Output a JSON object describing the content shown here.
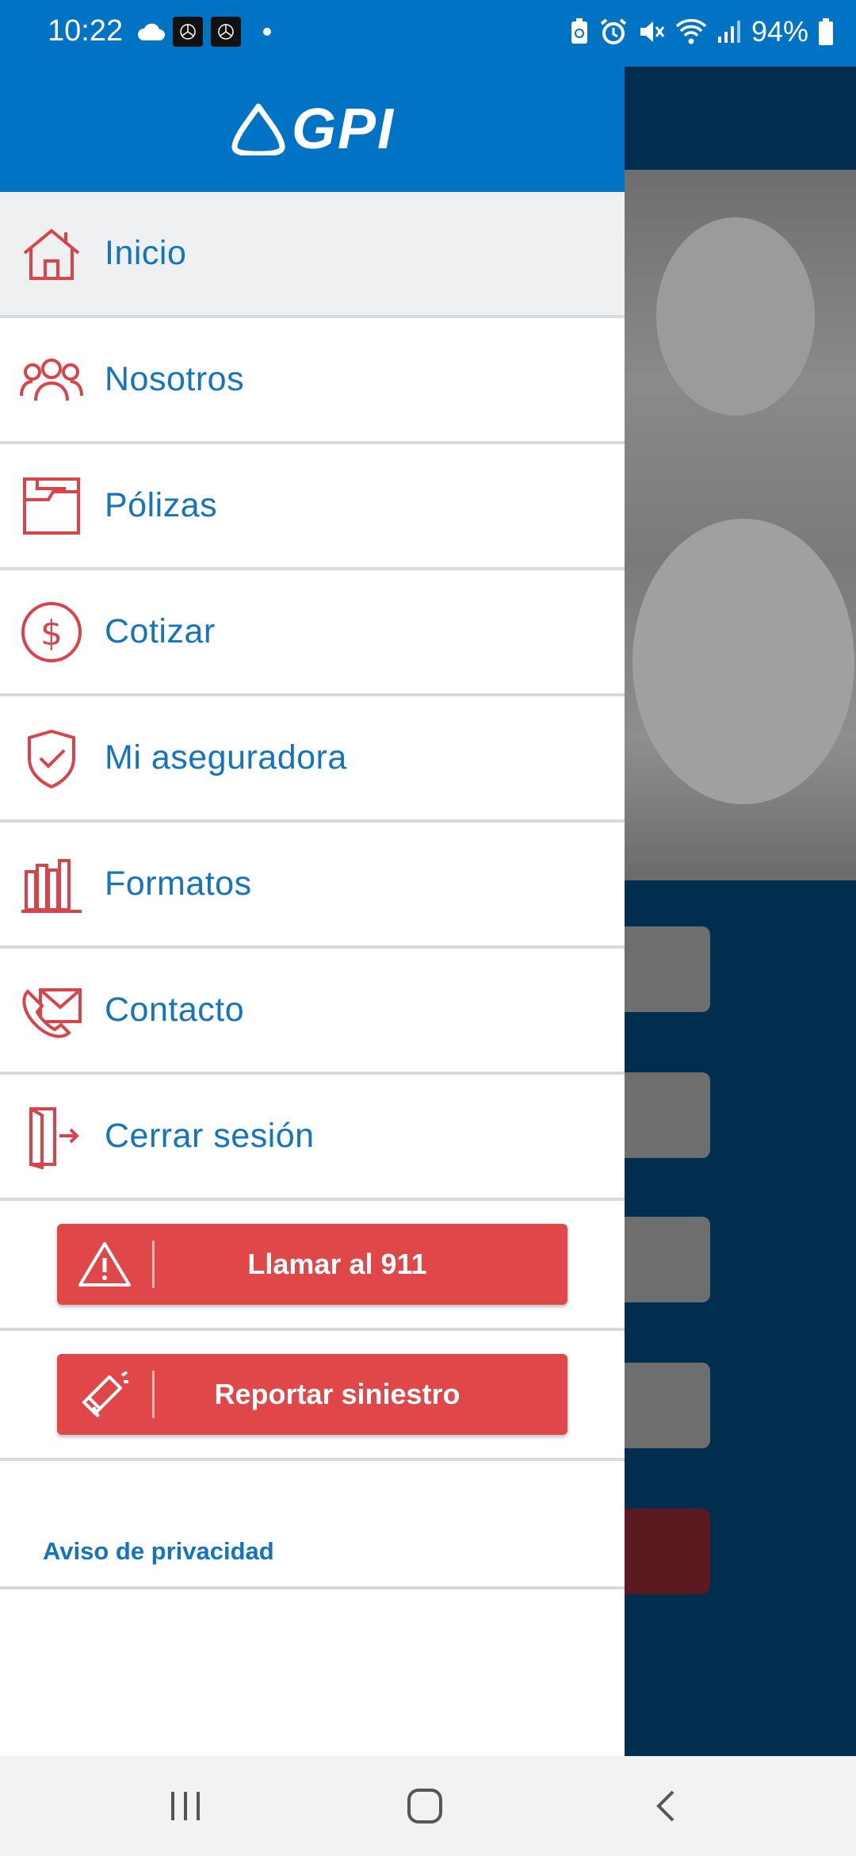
{
  "status_bar": {
    "time": "10:22",
    "battery": "94%",
    "icons_left": [
      "cloud-icon",
      "app-notification-icon",
      "app-notification-icon",
      "dot-icon"
    ],
    "icons_right": [
      "battery-saver-icon",
      "alarm-icon",
      "mute-icon",
      "wifi-icon",
      "signal-icon",
      "battery-icon"
    ]
  },
  "drawer": {
    "logo_text": "GPI",
    "menu": [
      {
        "label": "Inicio",
        "icon": "home-icon"
      },
      {
        "label": "Nosotros",
        "icon": "people-icon"
      },
      {
        "label": "Pólizas",
        "icon": "folder-icon"
      },
      {
        "label": "Cotizar",
        "icon": "dollar-coin-icon"
      },
      {
        "label": "Mi aseguradora",
        "icon": "shield-check-icon"
      },
      {
        "label": "Formatos",
        "icon": "bookshelf-icon"
      },
      {
        "label": "Contacto",
        "icon": "phone-mail-icon"
      },
      {
        "label": "Cerrar sesión",
        "icon": "logout-icon"
      }
    ],
    "actions": {
      "call_911": {
        "label": "Llamar al 911",
        "icon": "warning-icon"
      },
      "report": {
        "label": "Reportar siniestro",
        "icon": "megaphone-icon"
      }
    },
    "privacy_label": "Aviso de privacidad"
  },
  "colors": {
    "primary_blue": "#0173c4",
    "text_blue": "#1474bd",
    "accent_red": "#df4748",
    "icon_red": "#d9434a",
    "dark_navy": "#012d4f"
  }
}
